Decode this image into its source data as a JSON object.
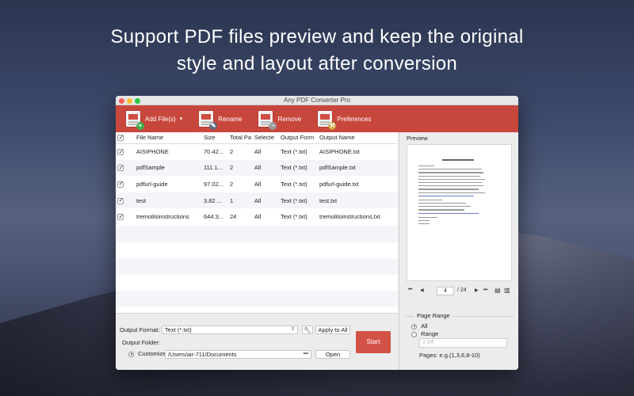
{
  "headline": {
    "line1": "Support PDF files preview and keep the original",
    "line2": "style and layout after conversion"
  },
  "window": {
    "title": "Any PDF Converter Pro"
  },
  "toolbar": {
    "add_label": "Add File(s)",
    "add_arrow": "▾",
    "rename_label": "Rename",
    "remove_label": "Remove",
    "preferences_label": "Preferences"
  },
  "table": {
    "headers": [
      "File Name",
      "Size",
      "Total Pa",
      "Selecte",
      "Output Form",
      "Output Name"
    ],
    "rows": [
      {
        "name": "AISIPHONE",
        "size": "70.42...",
        "pages": "2",
        "selected": "All",
        "format": "Text (*.txt)",
        "output": "AISIPHONE.txt"
      },
      {
        "name": "pdfSample",
        "size": "111.1...",
        "pages": "2",
        "selected": "All",
        "format": "Text (*.txt)",
        "output": "pdfSample.txt"
      },
      {
        "name": "pdfurl-guide",
        "size": "97.02...",
        "pages": "2",
        "selected": "All",
        "format": "Text (*.txt)",
        "output": "pdfurl-guide.txt"
      },
      {
        "name": "test",
        "size": "3.82 ...",
        "pages": "1",
        "selected": "All",
        "format": "Text (*.txt)",
        "output": "test.txt"
      },
      {
        "name": "tremolitoinstructions",
        "size": "644.3...",
        "pages": "24",
        "selected": "All",
        "format": "Text (*.txt)",
        "output": "tremolitoinstructions.txt"
      }
    ]
  },
  "output": {
    "format_label": "Output Format:",
    "format_value": "Text (*.txt)",
    "apply_all": "Apply to All",
    "folder_label": "Output Folder:",
    "customize_label": "Customize:",
    "folder_path": "/Users/air-711/Documents",
    "browse": "•••",
    "open": "Open",
    "start": "Start"
  },
  "preview": {
    "label": "Preview",
    "current_page": "4",
    "total_pages": "/ 24"
  },
  "page_range": {
    "title": "Page Range",
    "all": "All",
    "range": "Range",
    "placeholder": "1-24",
    "hint": "Pages: e.g.(1,3,6,8-10)"
  },
  "colors": {
    "toolbar": "#c8473d",
    "start": "#d35247"
  }
}
